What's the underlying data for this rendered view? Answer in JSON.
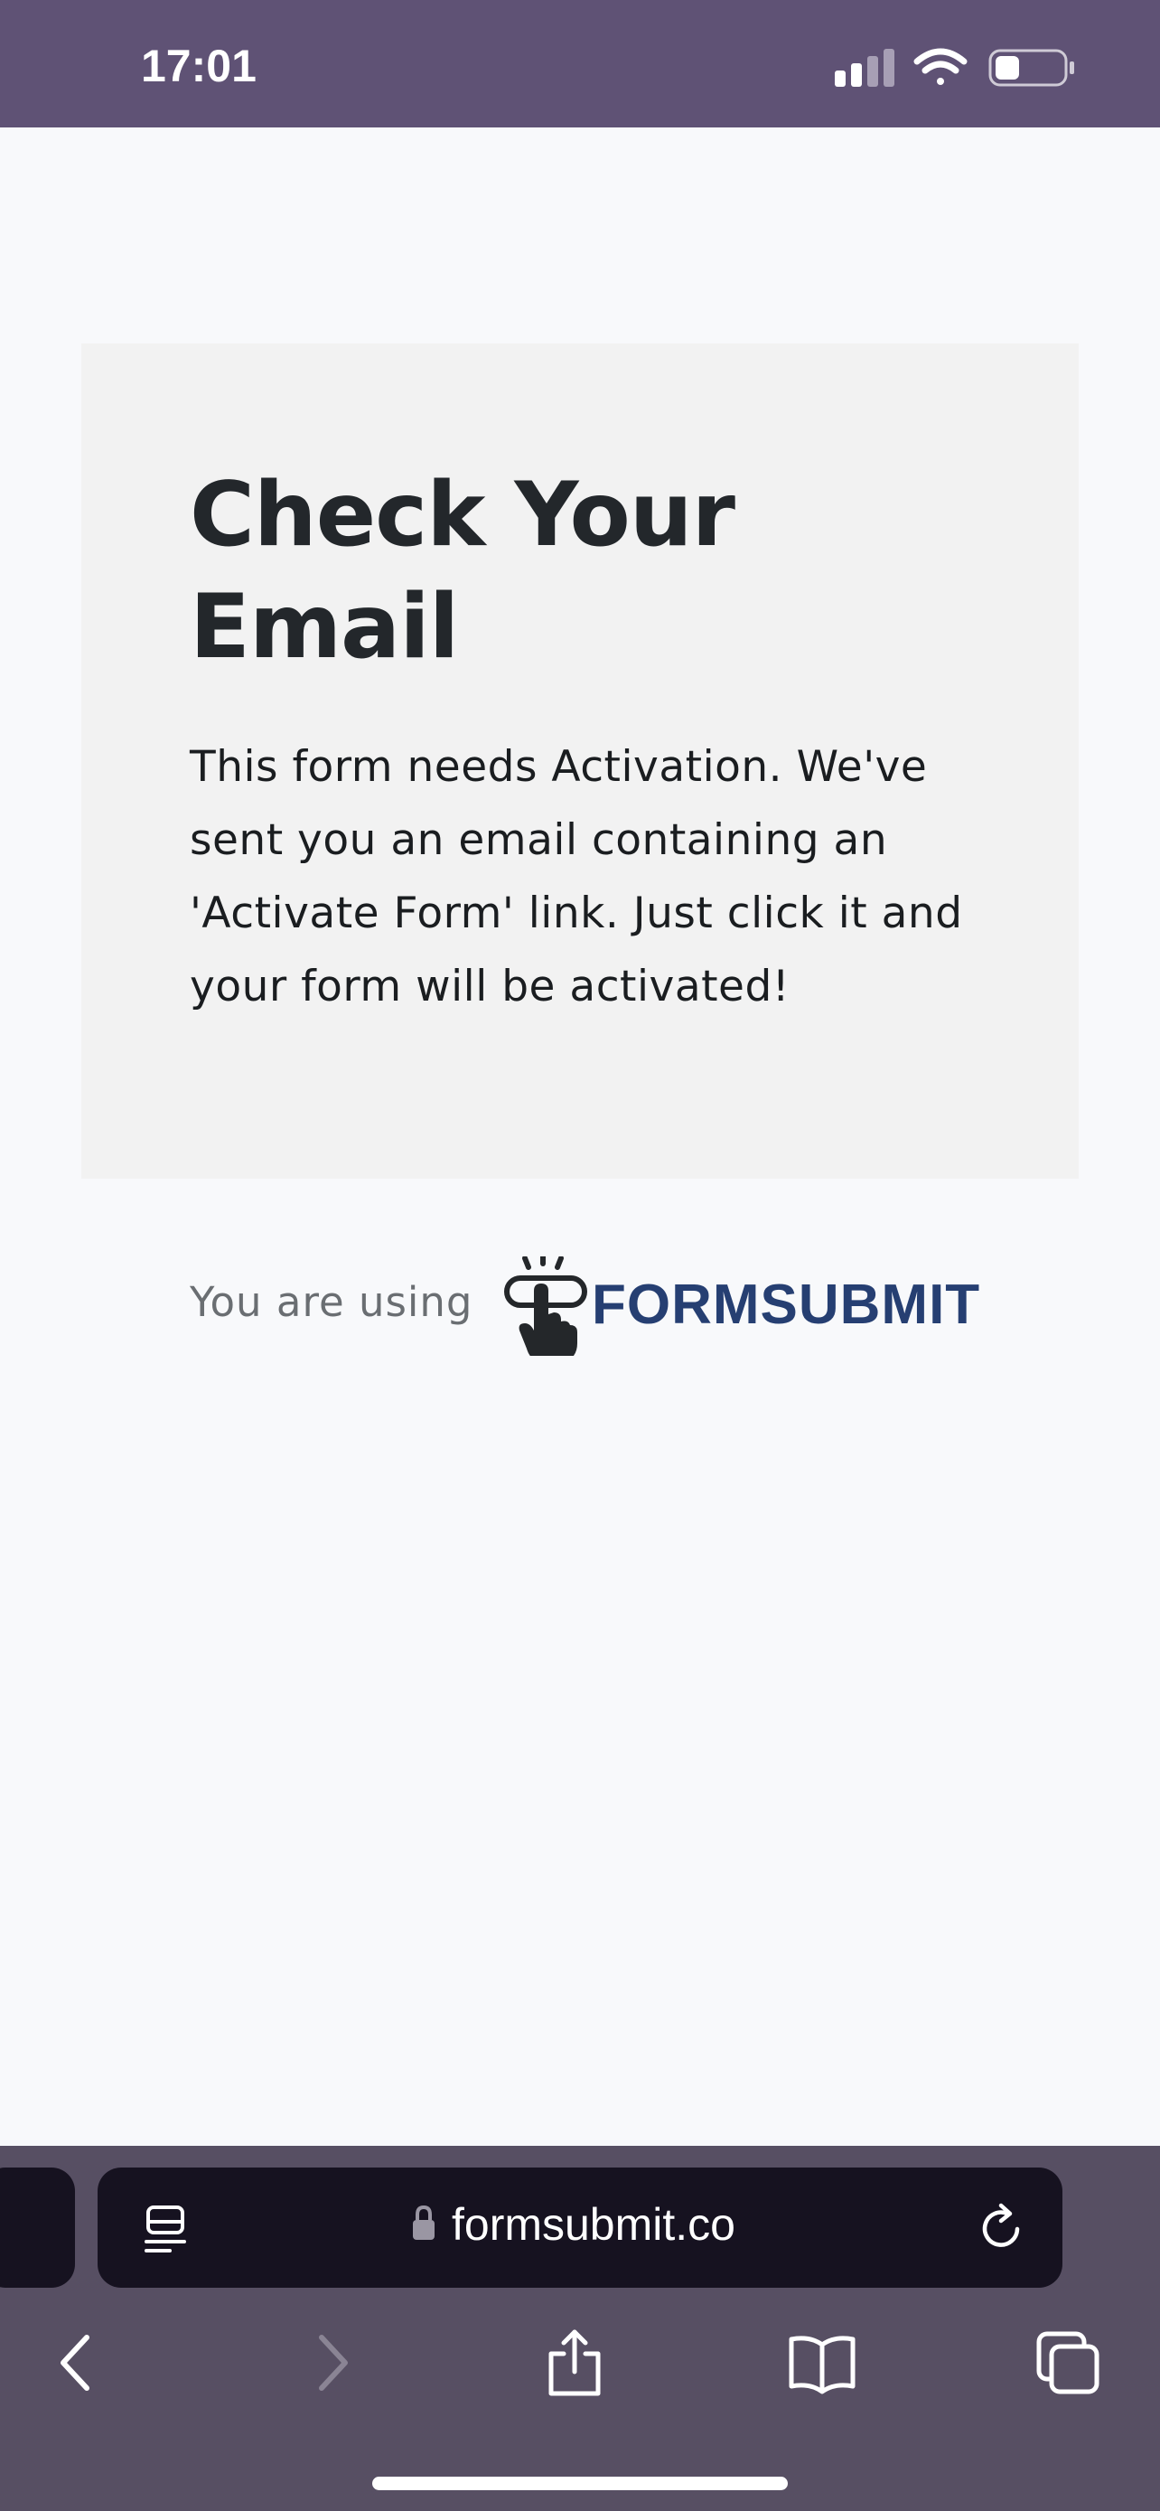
{
  "status_bar": {
    "time": "17:01",
    "icons": [
      "cellular-signal-icon",
      "wifi-icon",
      "battery-icon"
    ],
    "color": "#5f5275"
  },
  "card": {
    "title_line1": "Check Your",
    "title_line2": "Email",
    "body": "This form needs Activation. We've sent you an email containing an 'Activate Form' link. Just click it and your form will be activated!"
  },
  "footer": {
    "using_text": "You are using",
    "logo_text": "FORMSUBMIT",
    "logo_color": "#263f72"
  },
  "browser": {
    "url": "formsubmit.co",
    "icons": [
      "tab-menu-icon",
      "lock-icon",
      "reload-icon",
      "back-icon",
      "forward-icon",
      "share-icon",
      "bookmarks-icon",
      "tabs-icon"
    ],
    "bar_color": "#574f63"
  }
}
